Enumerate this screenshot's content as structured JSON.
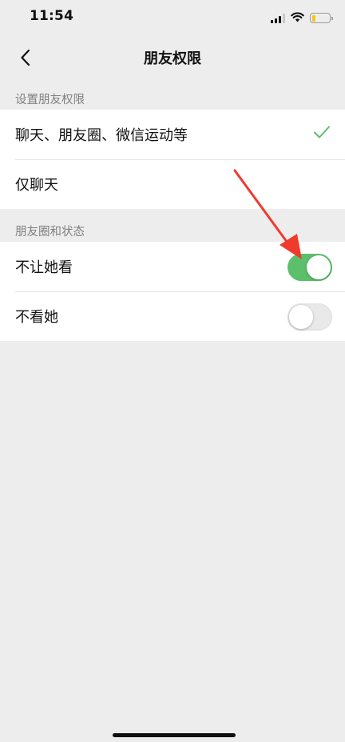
{
  "status_bar": {
    "time": "11:54",
    "icons": [
      "signal-icon",
      "wifi-icon",
      "battery-icon"
    ]
  },
  "nav": {
    "back_icon": "chevron-left-icon",
    "title": "朋友权限"
  },
  "section_permissions": {
    "header": "设置朋友权限",
    "options": [
      {
        "label": "聊天、朋友圈、微信运动等",
        "selected": true
      },
      {
        "label": "仅聊天",
        "selected": false
      }
    ]
  },
  "section_moments": {
    "header": "朋友圈和状态",
    "toggles": [
      {
        "label": "不让她看",
        "on": true
      },
      {
        "label": "不看她",
        "on": false
      }
    ]
  },
  "colors": {
    "accent_green": "#5bbf6b",
    "check_green": "#5bbf6b",
    "annotation_red": "#f03a2e",
    "background": "#ededed"
  }
}
